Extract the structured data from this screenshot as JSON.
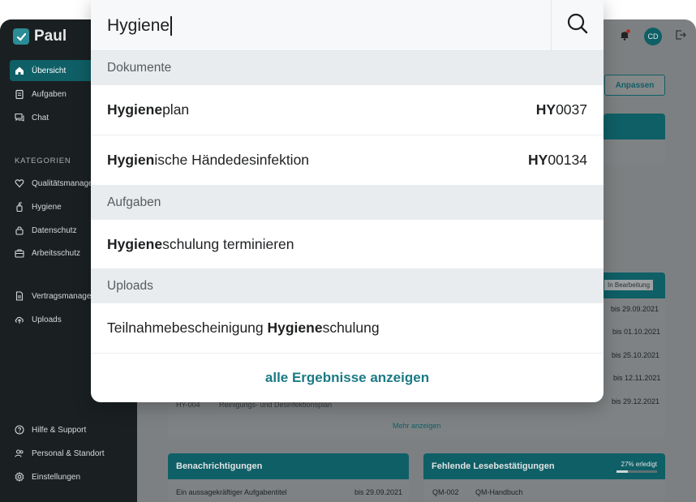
{
  "app": {
    "logo_text": "Paul",
    "avatar_initials": "CD",
    "customize_label": "Anpassen"
  },
  "sidebar": {
    "nav": [
      {
        "label": "Übersicht",
        "icon": "home-icon",
        "active": true
      },
      {
        "label": "Aufgaben",
        "icon": "clipboard-icon",
        "active": false
      },
      {
        "label": "Chat",
        "icon": "chat-icon",
        "active": false
      }
    ],
    "categories_heading": "KATEGORIEN",
    "categories": [
      {
        "label": "Qualitätsmanagement",
        "icon": "heart-icon"
      },
      {
        "label": "Hygiene",
        "icon": "soap-icon"
      },
      {
        "label": "Datenschutz",
        "icon": "lock-icon"
      },
      {
        "label": "Arbeitsschutz",
        "icon": "briefcase-icon"
      }
    ],
    "extra": [
      {
        "label": "Vertragsmanagement",
        "icon": "document-icon"
      },
      {
        "label": "Uploads",
        "icon": "upload-icon"
      }
    ],
    "footer": [
      {
        "label": "Hilfe & Support",
        "icon": "help-icon"
      },
      {
        "label": "Personal & Standort",
        "icon": "people-icon"
      },
      {
        "label": "Einstellungen",
        "icon": "gear-icon"
      }
    ]
  },
  "background": {
    "status_badge": "In Bearbeitung",
    "due_dates": [
      "bis 29.09.2021",
      "bis 01.10.2021",
      "bis 25.10.2021",
      "bis 12.11.2021",
      "bis 29.12.2021"
    ],
    "partial_row_code": "HY-004",
    "partial_row_title": "Reinigungs- und Desinfektionsplan",
    "more_label": "Mehr anzeigen",
    "notifications": {
      "title": "Benachrichtigungen",
      "row_text": "Ein aussagekräftiger Aufgabentitel",
      "row_date": "bis 29.09.2021"
    },
    "missing_reads": {
      "title": "Fehlende Lesebestätigungen",
      "progress_label": "27% erledigt",
      "progress": 0.27,
      "row_code": "QM-002",
      "row_title": "QM-Handbuch"
    }
  },
  "search": {
    "query": "Hygiene",
    "sections": [
      {
        "title": "Dokumente",
        "results": [
          {
            "prefix": "",
            "match": "Hygiene",
            "suffix": "plan",
            "code_match": "HY",
            "code_rest": "0037"
          },
          {
            "prefix": "",
            "match": "Hygien",
            "suffix": "ische Händedesinfektion",
            "code_match": "HY",
            "code_rest": "00134"
          }
        ]
      },
      {
        "title": "Aufgaben",
        "results": [
          {
            "prefix": "",
            "match": "Hygiene",
            "suffix": "schulung terminieren",
            "code_match": "",
            "code_rest": ""
          }
        ]
      },
      {
        "title": "Uploads",
        "results": [
          {
            "prefix": "Teilnahmebescheinigung ",
            "match": "Hygiene",
            "suffix": "schulung",
            "code_match": "",
            "code_rest": ""
          }
        ]
      }
    ],
    "show_all_label": "alle Ergebnisse anzeigen"
  },
  "colors": {
    "accent": "#1a7a84",
    "sidebar_bg": "#1a2022",
    "active_nav": "#0f5f66"
  }
}
